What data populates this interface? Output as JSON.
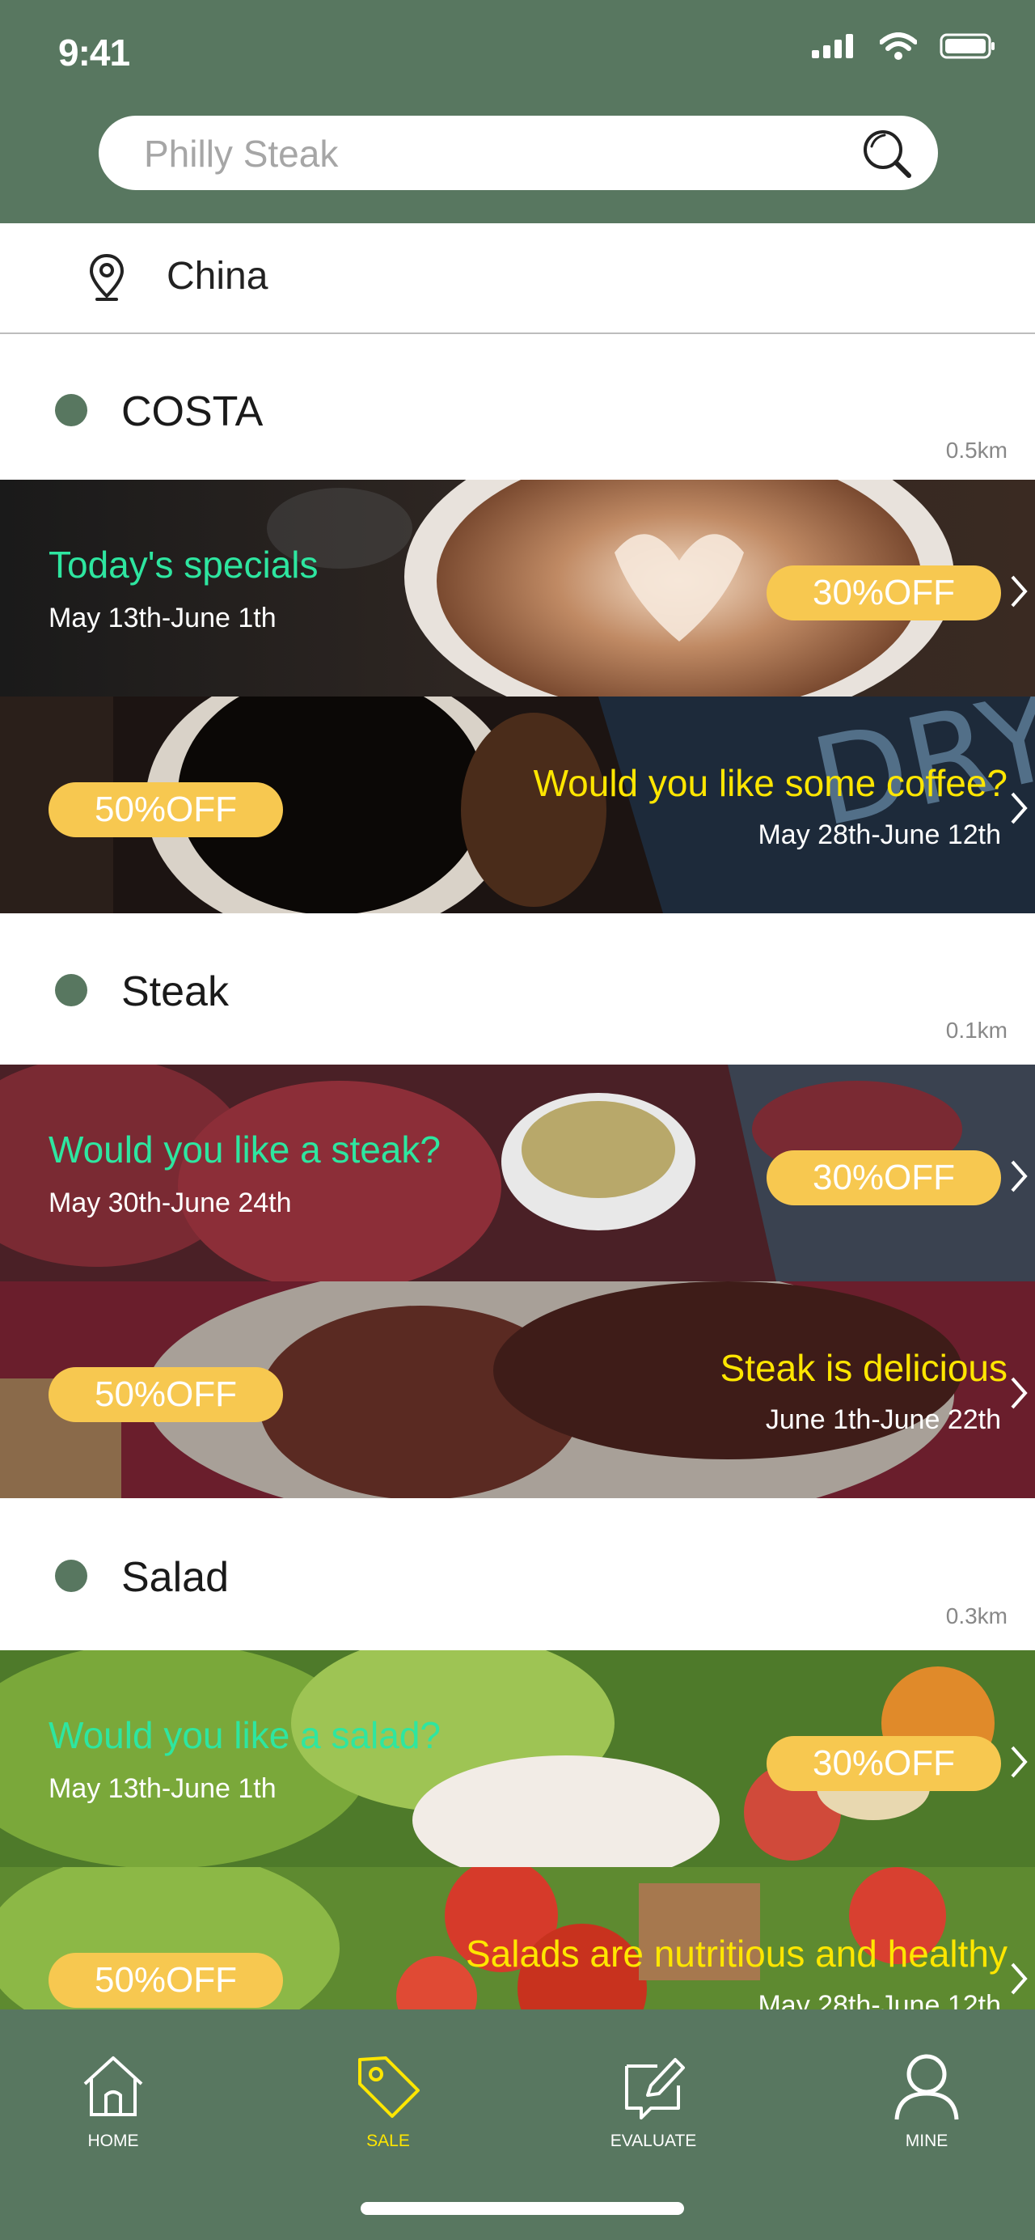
{
  "status_bar": {
    "time": "9:41"
  },
  "search": {
    "placeholder": "Philly Steak",
    "value": ""
  },
  "location": {
    "name": "China"
  },
  "stores": [
    {
      "name": "COSTA",
      "distance": "0.5km",
      "promos": [
        {
          "title": "Today's specials",
          "date": "May 13th-June 1th",
          "badge": "30%OFF"
        },
        {
          "title": "Would you like some coffee?",
          "date": "May 28th-June 12th",
          "badge": "50%OFF"
        }
      ]
    },
    {
      "name": "Steak",
      "distance": "0.1km",
      "promos": [
        {
          "title": "Would you like a steak?",
          "date": "May 30th-June 24th",
          "badge": "30%OFF"
        },
        {
          "title": "Steak is delicious",
          "date": "June 1th-June 22th",
          "badge": "50%OFF"
        }
      ]
    },
    {
      "name": "Salad",
      "distance": "0.3km",
      "promos": [
        {
          "title": "Would you like a salad?",
          "date": "May 13th-June 1th",
          "badge": "30%OFF"
        },
        {
          "title": "Salads are nutritious and healthy",
          "date": "May 28th-June 12th",
          "badge": "50%OFF"
        }
      ]
    }
  ],
  "tabs": [
    {
      "label": "HOME",
      "icon": "home-icon",
      "active": false
    },
    {
      "label": "SALE",
      "icon": "tag-icon",
      "active": true
    },
    {
      "label": "EVALUATE",
      "icon": "edit-icon",
      "active": false
    },
    {
      "label": "MINE",
      "icon": "user-icon",
      "active": false
    }
  ],
  "colors": {
    "brand_green": "#587760",
    "badge_yellow": "#f7c850",
    "green_text": "#2ee6a0",
    "yellow_text": "#ffe600"
  }
}
